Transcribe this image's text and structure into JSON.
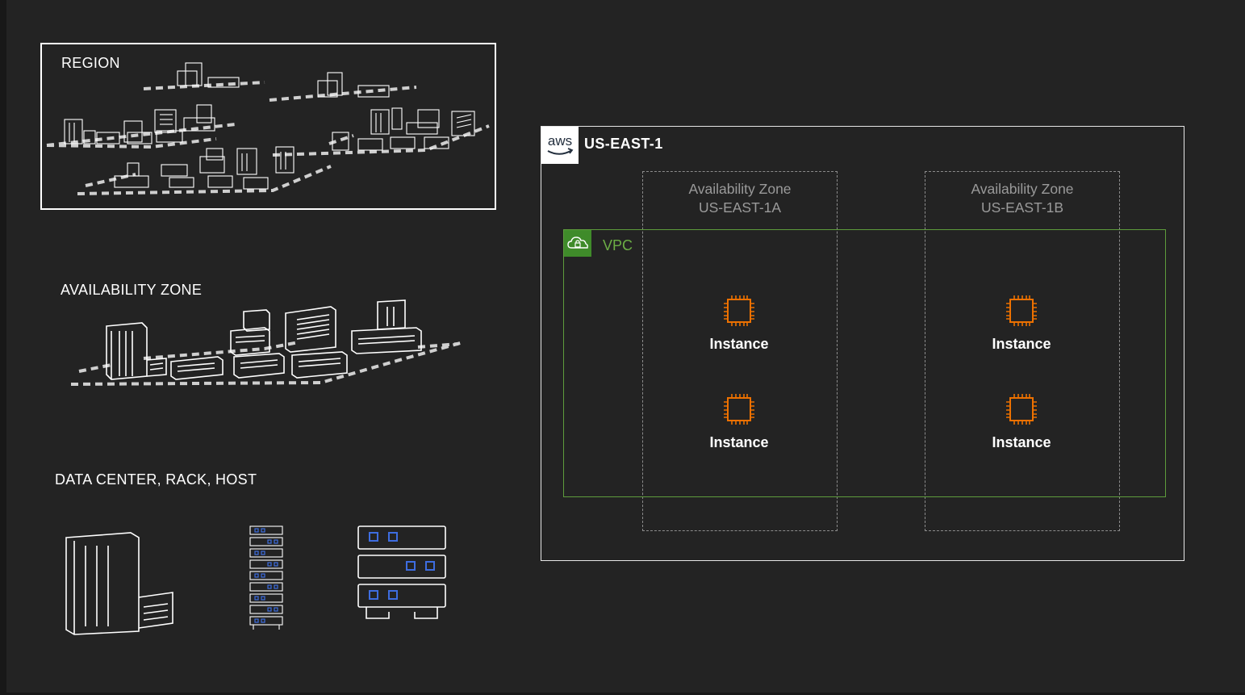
{
  "left_panel": {
    "region_label": "REGION",
    "az_label": "AVAILABILITY ZONE",
    "dc_label": "DATA CENTER, RACK, HOST"
  },
  "diagram": {
    "region": {
      "logo_text": "aws",
      "title": "US-EAST-1"
    },
    "availability_zones": [
      {
        "line1": "Availability Zone",
        "line2": "US-EAST-1A"
      },
      {
        "line1": "Availability Zone",
        "line2": "US-EAST-1B"
      }
    ],
    "vpc": {
      "label": "VPC",
      "icon": "cloud-lock-icon"
    },
    "instances": [
      {
        "label": "Instance",
        "icon": "chip-icon"
      },
      {
        "label": "Instance",
        "icon": "chip-icon"
      },
      {
        "label": "Instance",
        "icon": "chip-icon"
      },
      {
        "label": "Instance",
        "icon": "chip-icon"
      }
    ]
  },
  "colors": {
    "background": "#232323",
    "vpc_green": "#3f8b2a",
    "instance_orange": "#ed7100",
    "rack_blue": "#3e6de0"
  }
}
